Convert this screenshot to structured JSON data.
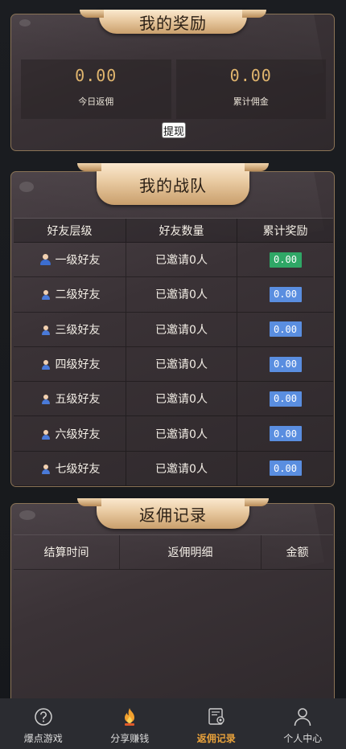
{
  "rewards": {
    "title": "我的奖励",
    "today_value": "0.00",
    "today_label": "今日返佣",
    "total_value": "0.00",
    "total_label": "累计佣金",
    "withdraw_label": "提现"
  },
  "team": {
    "title": "我的战队",
    "headers": [
      "好友层级",
      "好友数量",
      "累计奖励"
    ],
    "rows": [
      {
        "level": "一级好友",
        "count": "已邀请0人",
        "reward": "0.00",
        "reward_color": "#2fa766"
      },
      {
        "level": "二级好友",
        "count": "已邀请0人",
        "reward": "0.00",
        "reward_color": "#5a8ee0"
      },
      {
        "level": "三级好友",
        "count": "已邀请0人",
        "reward": "0.00",
        "reward_color": "#5a8ee0"
      },
      {
        "level": "四级好友",
        "count": "已邀请0人",
        "reward": "0.00",
        "reward_color": "#5a8ee0"
      },
      {
        "level": "五级好友",
        "count": "已邀请0人",
        "reward": "0.00",
        "reward_color": "#5a8ee0"
      },
      {
        "level": "六级好友",
        "count": "已邀请0人",
        "reward": "0.00",
        "reward_color": "#5a8ee0"
      },
      {
        "level": "七级好友",
        "count": "已邀请0人",
        "reward": "0.00",
        "reward_color": "#5a8ee0"
      }
    ]
  },
  "records": {
    "title": "返佣记录",
    "headers": [
      "结算时间",
      "返佣明细",
      "金额"
    ]
  },
  "tabbar": {
    "items": [
      {
        "label": "爆点游戏",
        "icon": "question-circle-icon"
      },
      {
        "label": "分享赚钱",
        "icon": "fire-icon"
      },
      {
        "label": "返佣记录",
        "icon": "certificate-document-icon"
      },
      {
        "label": "个人中心",
        "icon": "user-icon"
      }
    ],
    "active_color": "#e9a23b"
  }
}
